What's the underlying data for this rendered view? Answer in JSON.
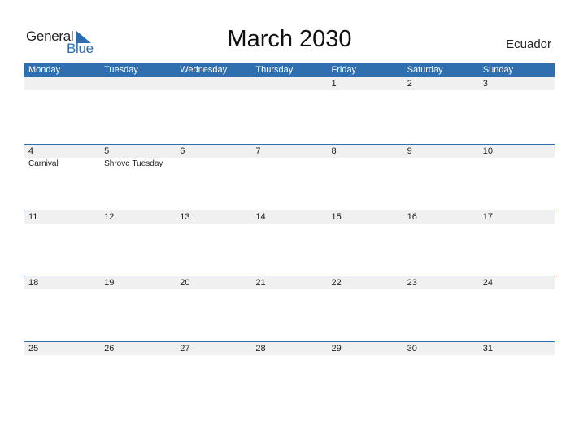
{
  "logo": {
    "word1": "General",
    "word2": "Blue"
  },
  "title": "March 2030",
  "country": "Ecuador",
  "colors": {
    "accent": "#2f6fb0",
    "strip": "#f0f0f0"
  },
  "weekdays": [
    "Monday",
    "Tuesday",
    "Wednesday",
    "Thursday",
    "Friday",
    "Saturday",
    "Sunday"
  ],
  "weeks": [
    {
      "days": [
        "",
        "",
        "",
        "",
        "1",
        "2",
        "3"
      ],
      "events": [
        "",
        "",
        "",
        "",
        "",
        "",
        ""
      ]
    },
    {
      "days": [
        "4",
        "5",
        "6",
        "7",
        "8",
        "9",
        "10"
      ],
      "events": [
        "Carnival",
        "Shrove Tuesday",
        "",
        "",
        "",
        "",
        ""
      ]
    },
    {
      "days": [
        "11",
        "12",
        "13",
        "14",
        "15",
        "16",
        "17"
      ],
      "events": [
        "",
        "",
        "",
        "",
        "",
        "",
        ""
      ]
    },
    {
      "days": [
        "18",
        "19",
        "20",
        "21",
        "22",
        "23",
        "24"
      ],
      "events": [
        "",
        "",
        "",
        "",
        "",
        "",
        ""
      ]
    },
    {
      "days": [
        "25",
        "26",
        "27",
        "28",
        "29",
        "30",
        "31"
      ],
      "events": [
        "",
        "",
        "",
        "",
        "",
        "",
        ""
      ]
    }
  ]
}
